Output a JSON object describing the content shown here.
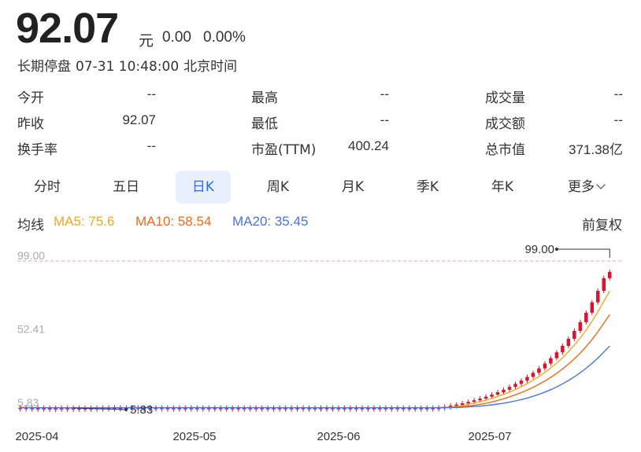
{
  "quote": {
    "price": "92.07",
    "unit": "元",
    "change": "0.00",
    "change_pct": "0.00%",
    "status": "长期停盘",
    "datetime": "07-31 10:48:00",
    "timezone": "北京时间"
  },
  "stats": [
    {
      "label": "今开",
      "value": "--"
    },
    {
      "label": "最高",
      "value": "--"
    },
    {
      "label": "成交量",
      "value": "--"
    },
    {
      "label": "昨收",
      "value": "92.07"
    },
    {
      "label": "最低",
      "value": "--"
    },
    {
      "label": "成交额",
      "value": "--"
    },
    {
      "label": "换手率",
      "value": "--"
    },
    {
      "label": "市盈(TTM)",
      "value": "400.24"
    },
    {
      "label": "总市值",
      "value": "371.38亿"
    }
  ],
  "tabs": [
    {
      "label": "分时"
    },
    {
      "label": "五日"
    },
    {
      "label": "日K",
      "active": true
    },
    {
      "label": "周K"
    },
    {
      "label": "月K"
    },
    {
      "label": "季K"
    },
    {
      "label": "年K"
    },
    {
      "label": "更多"
    }
  ],
  "ma": {
    "title": "均线",
    "ma5": "MA5: 75.6",
    "ma10": "MA10: 58.54",
    "ma20": "MA20: 35.45",
    "adjust": "前复权"
  },
  "colors": {
    "up": "#d9142e",
    "ma5": "#f5a623",
    "ma10": "#f26a1b",
    "ma20": "#4a74e0",
    "active_tab": "#2b6de8",
    "dashed": "#f5a0a0"
  },
  "chart_data": {
    "type": "candlestick",
    "y_ticks": [
      "99.00",
      "52.41",
      "5.83"
    ],
    "ylim": [
      5.83,
      99.0
    ],
    "x_ticks": [
      "2025-04",
      "2025-05",
      "2025-06",
      "2025-07"
    ],
    "high_label": "99.00",
    "low_label": "5.83",
    "series": [
      {
        "name": "MA5"
      },
      {
        "name": "MA10"
      },
      {
        "name": "MA20"
      }
    ],
    "candles_close": [
      6.1,
      6.0,
      5.9,
      5.9,
      5.9,
      5.9,
      5.9,
      5.9,
      5.9,
      5.83,
      5.9,
      5.9,
      5.9,
      6.0,
      6.0,
      6.1,
      6.1,
      6.0,
      6.0,
      6.1,
      6.0,
      6.0,
      6.0,
      6.1,
      6.0,
      6.0,
      6.0,
      6.0,
      6.0,
      6.0,
      6.0,
      6.0,
      6.0,
      6.0,
      6.0,
      6.0,
      6.0,
      6.0,
      6.0,
      6.0,
      6.0,
      6.0,
      6.0,
      6.0,
      6.0,
      6.0,
      6.0,
      6.0,
      6.0,
      6.0,
      6.0,
      6.0,
      6.0,
      6.0,
      6.0,
      6.0,
      6.0,
      6.0,
      6.0,
      6.0,
      6.0,
      6.0,
      6.0,
      6.0,
      6.0,
      6.0,
      6.0,
      6.0,
      6.0,
      6.0,
      6.0,
      6.1,
      6.6,
      7.3,
      8.0,
      8.8,
      9.7,
      10.7,
      11.8,
      13.0,
      14.3,
      15.8,
      17.4,
      19.2,
      21.1,
      23.2,
      25.5,
      28.1,
      30.9,
      34.0,
      37.4,
      41.1,
      45.2,
      49.7,
      54.7,
      60.2,
      66.2,
      72.8,
      80.1,
      88.1,
      92.07
    ]
  }
}
